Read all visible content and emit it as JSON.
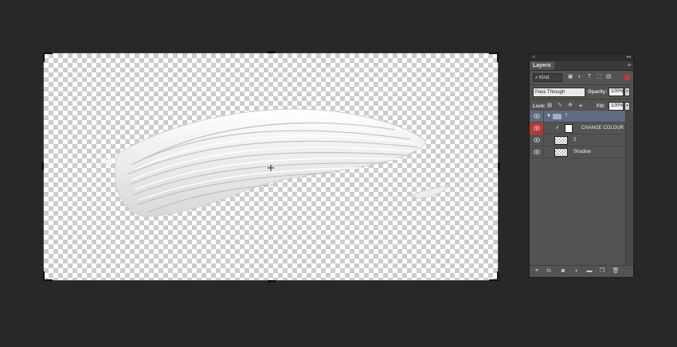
{
  "panel": {
    "tab_label": "Layers",
    "close_glyph": "×",
    "collapse_glyph": "◂◂",
    "menu_glyph": "≡",
    "filter": {
      "kind_label": "Kind",
      "search_glyph": "⌕",
      "icons": [
        "image-filter-icon",
        "adjustment-filter-icon",
        "type-filter-icon",
        "shape-filter-icon",
        "smart-object-filter-icon"
      ],
      "filter_toggle_color": "#b23b3b"
    },
    "blend_mode": "Pass Through",
    "opacity_label": "Opacity:",
    "opacity_value": "100%",
    "lock_label": "Lock:",
    "fill_label": "Fill:",
    "fill_value": "100%",
    "layers": [
      {
        "name": "7",
        "type": "group",
        "selected": true,
        "visible": true
      },
      {
        "name": "CHANGE COLOUR",
        "type": "fill",
        "clipped": true,
        "visible": true,
        "highlight": "#b23b3b"
      },
      {
        "name": "2",
        "type": "pixel",
        "visible": true
      },
      {
        "name": "Shadow",
        "type": "pixel",
        "visible": true
      }
    ],
    "bottom_icons": [
      "link-layers-icon",
      "fx-icon",
      "mask-icon",
      "adjustment-layer-icon",
      "new-group-icon",
      "new-layer-icon",
      "trash-icon"
    ],
    "bottom_glyphs": {
      "fx": "fx."
    }
  },
  "colors": {
    "workspace_bg": "#282828",
    "panel_bg": "#535353",
    "selection": "#5f6b82",
    "stroke": "#f2f2f2"
  }
}
